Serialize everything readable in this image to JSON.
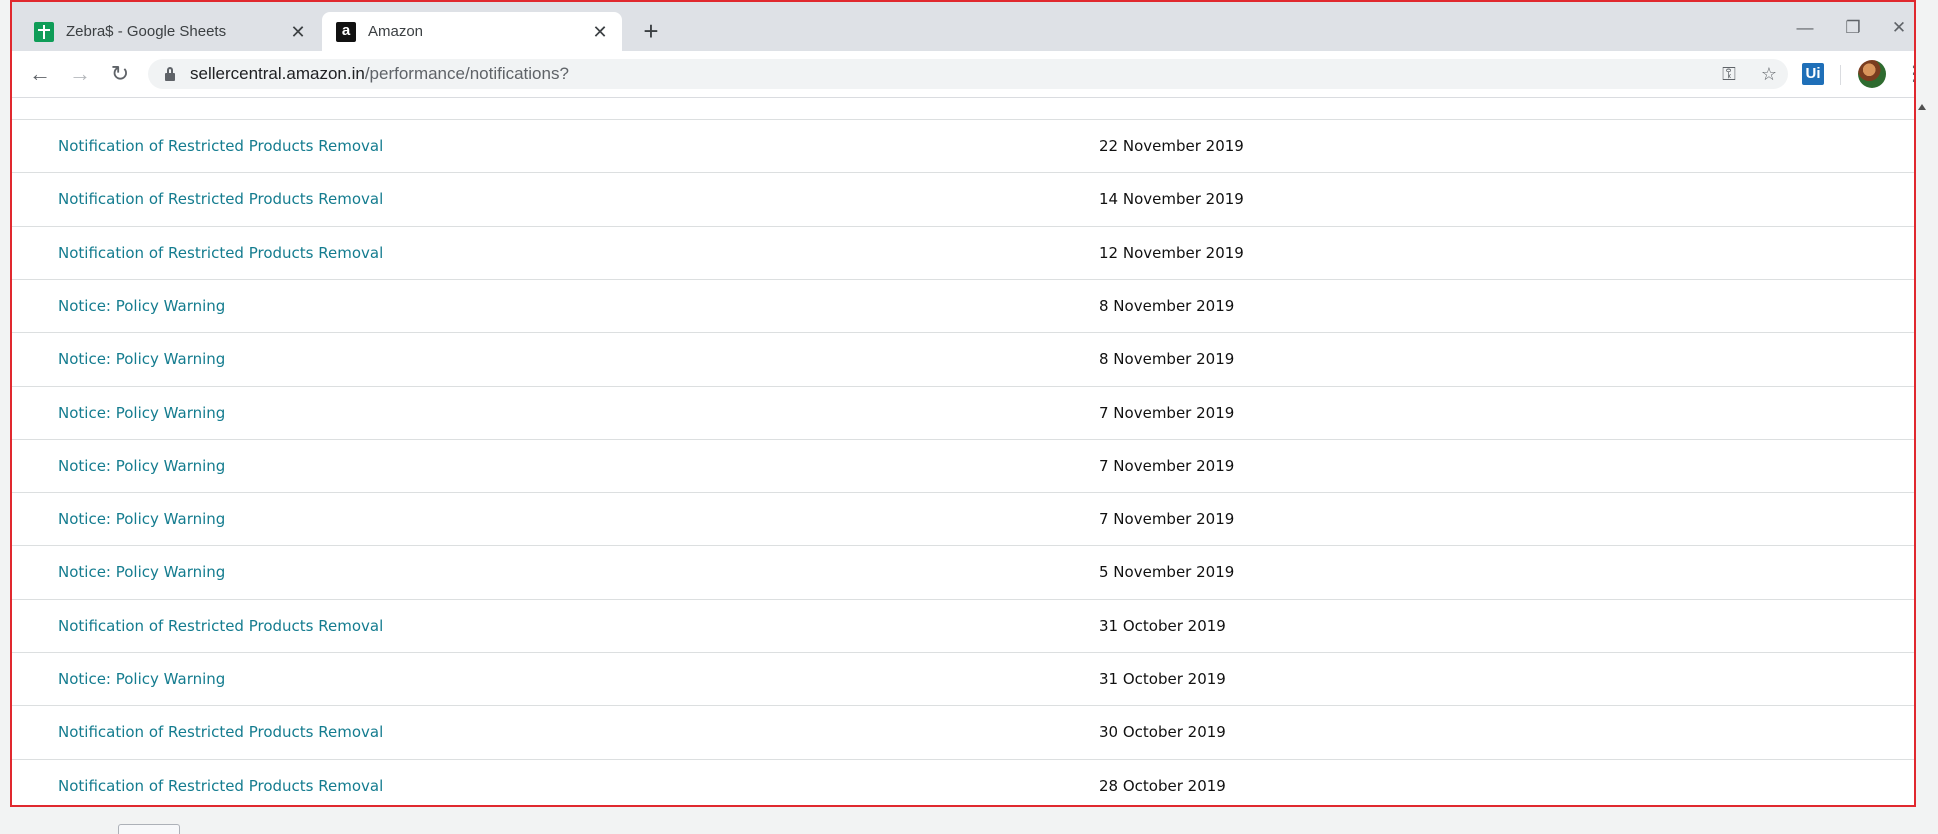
{
  "browser": {
    "tabs": [
      {
        "title": "Zebra$ - Google Sheets",
        "icon": "google-sheets-icon",
        "active": false
      },
      {
        "title": "Amazon",
        "icon": "amazon-icon",
        "active": true
      }
    ],
    "close_glyph": "✕",
    "new_tab_glyph": "+",
    "window_controls": {
      "minimize": "—",
      "maximize": "❐",
      "close": "✕"
    },
    "nav": {
      "back": "←",
      "forward": "→",
      "reload": "↻"
    },
    "url": {
      "host": "sellercentral.amazon.in",
      "path": "/performance/notifications?"
    },
    "key_glyph": "⚿",
    "star_glyph": "☆",
    "extension_label": "Ui",
    "menu_glyph": "⋮",
    "favicon_amazon_letter": "a"
  },
  "notifications": [
    {
      "title": "Notification of Restricted Products Removal",
      "date": "22 November 2019"
    },
    {
      "title": "Notification of Restricted Products Removal",
      "date": "14 November 2019"
    },
    {
      "title": "Notification of Restricted Products Removal",
      "date": "12 November 2019"
    },
    {
      "title": "Notice: Policy Warning",
      "date": "8 November 2019"
    },
    {
      "title": "Notice: Policy Warning",
      "date": "8 November 2019"
    },
    {
      "title": "Notice: Policy Warning",
      "date": "7 November 2019"
    },
    {
      "title": "Notice: Policy Warning",
      "date": "7 November 2019"
    },
    {
      "title": "Notice: Policy Warning",
      "date": "7 November 2019"
    },
    {
      "title": "Notice: Policy Warning",
      "date": "5 November 2019"
    },
    {
      "title": "Notification of Restricted Products Removal",
      "date": "31 October 2019"
    },
    {
      "title": "Notice: Policy Warning",
      "date": "31 October 2019"
    },
    {
      "title": "Notification of Restricted Products Removal",
      "date": "30 October 2019"
    },
    {
      "title": "Notification of Restricted Products Removal",
      "date": "28 October 2019"
    }
  ],
  "colors": {
    "link": "#147c8f",
    "frame_border": "#e0282e",
    "tab_strip": "#dee1e6"
  }
}
